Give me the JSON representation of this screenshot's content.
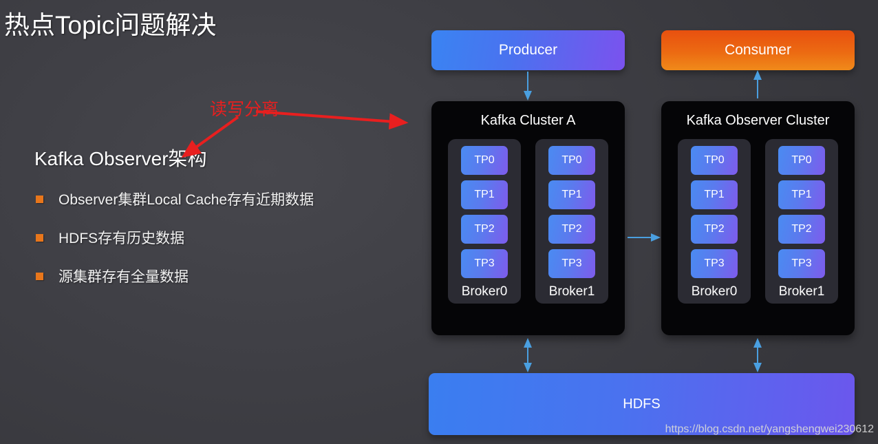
{
  "slide": {
    "title": "热点Topic问题解决",
    "background_color": "#3f3f45"
  },
  "left_panel": {
    "heading": "Kafka Observer架构",
    "bullet_color": "#e8761b",
    "bullets": [
      {
        "text": "Observer集群Local Cache存有近期数据"
      },
      {
        "text": "HDFS存有历史数据"
      },
      {
        "text": "源集群存有全量数据"
      }
    ]
  },
  "annotation": {
    "label": "读写分离",
    "color": "#e81f1f"
  },
  "diagram": {
    "producer": {
      "label": "Producer",
      "color_start": "#3a84f2",
      "color_end": "#7b52ee"
    },
    "consumer": {
      "label": "Consumer",
      "color_start": "#e8500f",
      "color_end": "#f08a1a"
    },
    "arrow_color": "#4a9fe0",
    "clusters": [
      {
        "title": "Kafka Cluster A",
        "brokers": [
          {
            "label": "Broker0",
            "partitions": [
              "TP0",
              "TP1",
              "TP2",
              "TP3"
            ]
          },
          {
            "label": "Broker1",
            "partitions": [
              "TP0",
              "TP1",
              "TP2",
              "TP3"
            ]
          }
        ]
      },
      {
        "title": "Kafka Observer Cluster",
        "brokers": [
          {
            "label": "Broker0",
            "partitions": [
              "TP0",
              "TP1",
              "TP2",
              "TP3"
            ]
          },
          {
            "label": "Broker1",
            "partitions": [
              "TP0",
              "TP1",
              "TP2",
              "TP3"
            ]
          }
        ]
      }
    ],
    "storage": {
      "label": "HDFS",
      "color_start": "#3a7ef0",
      "color_end": "#6b57ed"
    }
  },
  "watermark": "https://blog.csdn.net/yangshengwei230612"
}
